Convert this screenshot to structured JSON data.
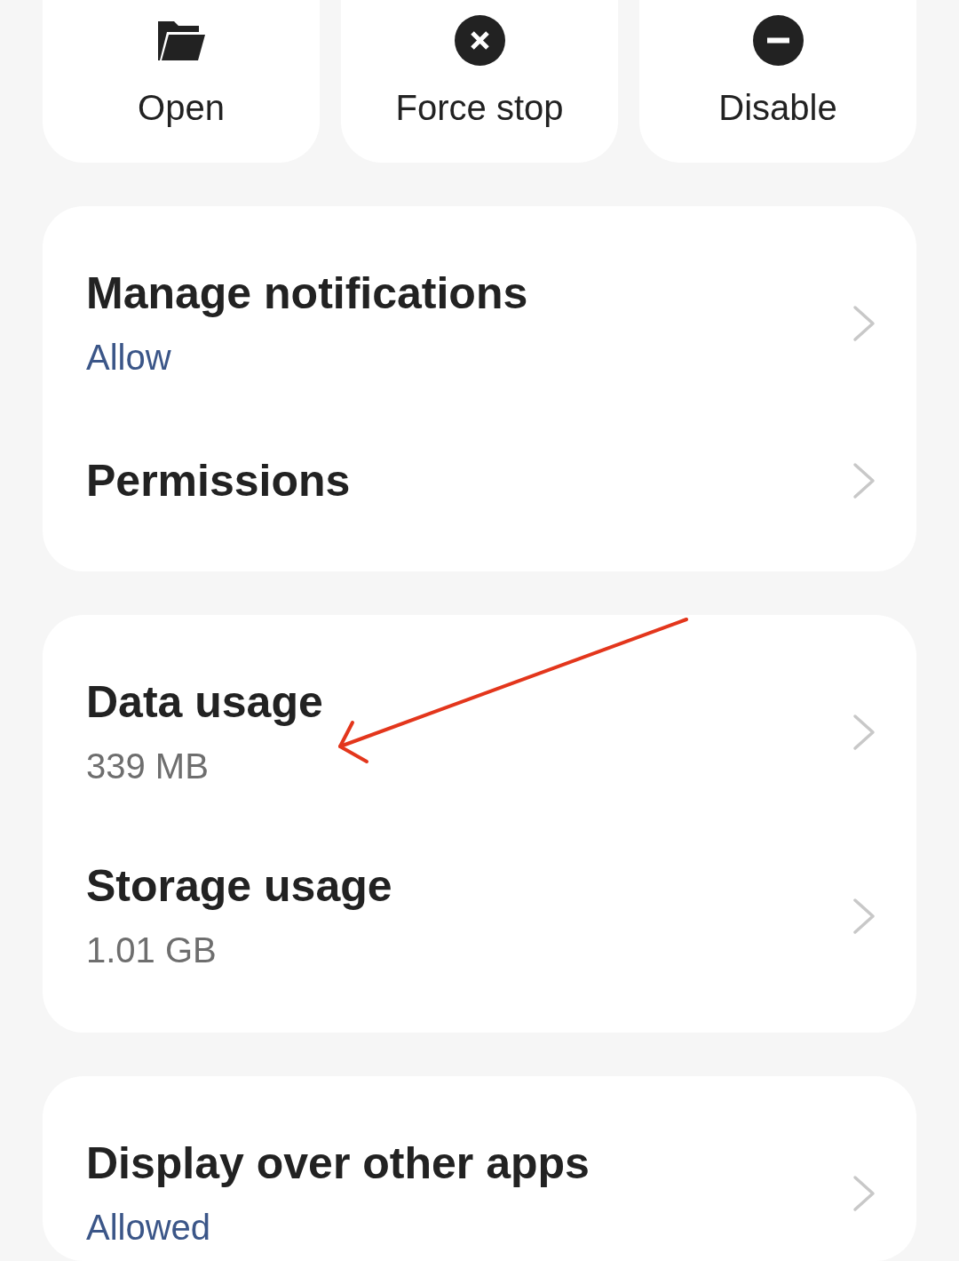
{
  "action_buttons": [
    {
      "kind": "open",
      "label": "Open"
    },
    {
      "kind": "force_stop",
      "label": "Force stop"
    },
    {
      "kind": "disable",
      "label": "Disable"
    }
  ],
  "cards": [
    {
      "items": [
        {
          "kind": "status",
          "title": "Manage notifications",
          "subtitle": "Allow"
        },
        {
          "kind": "plain",
          "title": "Permissions"
        }
      ]
    },
    {
      "items": [
        {
          "kind": "value",
          "title": "Data usage",
          "subtitle": "339 MB"
        },
        {
          "kind": "value",
          "title": "Storage usage",
          "subtitle": "1.01 GB"
        }
      ]
    },
    {
      "items": [
        {
          "kind": "status",
          "title": "Display over other apps",
          "subtitle": "Allowed"
        }
      ]
    }
  ],
  "annotations": [
    {
      "kind": "arrow"
    }
  ]
}
